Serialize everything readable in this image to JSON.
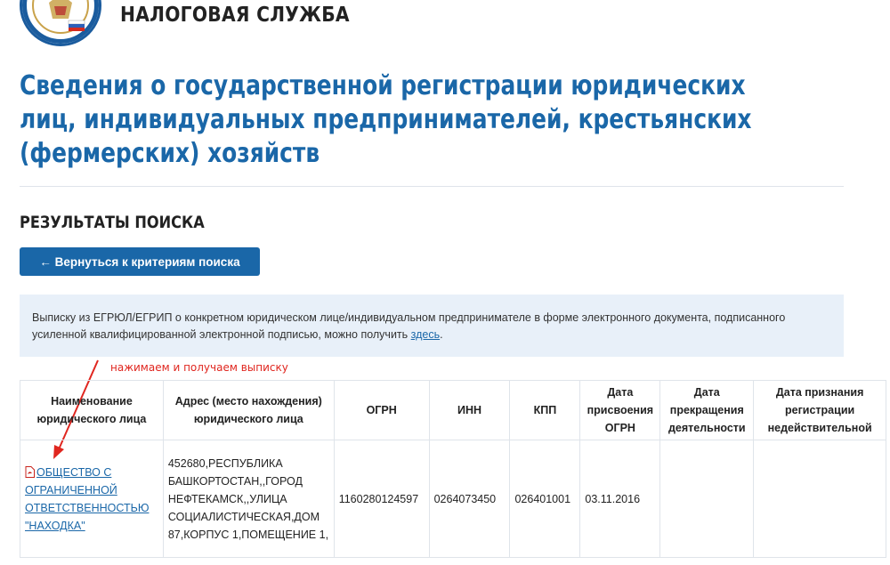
{
  "header": {
    "service_name": "НАЛОГОВАЯ СЛУЖБА",
    "logo_icon": "fns-emblem-icon"
  },
  "page_title": "Сведения о государственной регистрации юридических лиц, индивидуальных предпринимателей, крестьянских (фермерских) хозяйств",
  "results_heading": "РЕЗУЛЬТАТЫ ПОИСКА",
  "back_button": {
    "label": "← Вернуться к критериям поиска"
  },
  "info": {
    "text_before": "Выписку из ЕГРЮЛ/ЕГРИП о конкретном юридическом лице/индивидуальном предпринимателе в форме электронного документа, подписанного усиленной квалифицированной электронной подписью, можно получить ",
    "link_text": "здесь",
    "text_after": "."
  },
  "annotation": {
    "text": "нажимаем и получаем выписку",
    "color": "#e0261f"
  },
  "table": {
    "headers": {
      "name": "Наименование юридического лица",
      "address": "Адрес (место нахождения) юридического лица",
      "ogrn": "ОГРН",
      "inn": "ИНН",
      "kpp": "КПП",
      "ogrn_date": "Дата присвоения ОГРН",
      "end_date": "Дата прекращения деятельности",
      "invalid_date": "Дата признания регистрации недействительной"
    },
    "rows": [
      {
        "name": "ОБЩЕСТВО С ОГРАНИЧЕННОЙ ОТВЕТСТВЕННОСТЬЮ \"НАХОДКА\"",
        "name_icon": "pdf-icon",
        "address": "452680,РЕСПУБЛИКА БАШКОРТОСТАН,,ГОРОД НЕФТЕКАМСК,,УЛИЦА СОЦИАЛИСТИЧЕСКАЯ,ДОМ 87,КОРПУС 1,ПОМЕЩЕНИЕ 1,",
        "ogrn": "1160280124597",
        "inn": "0264073450",
        "kpp": "026401001",
        "ogrn_date": "03.11.2016",
        "end_date": "",
        "invalid_date": ""
      }
    ]
  },
  "colors": {
    "brand_blue": "#1a67a8",
    "info_bg": "#e8f0f9",
    "annotation_red": "#e0261f"
  }
}
